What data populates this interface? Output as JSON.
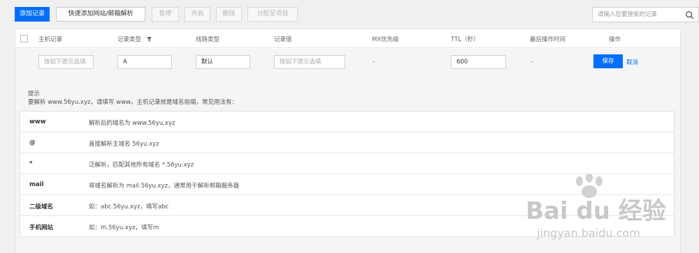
{
  "toolbar": {
    "add_record": "添加记录",
    "quick_add": "快速添加网站/邮箱解析",
    "pause": "暂停",
    "enable": "开启",
    "delete": "删除",
    "assign_project": "分配至项目"
  },
  "search": {
    "placeholder": "请输入您要搜索的记录"
  },
  "table": {
    "headers": {
      "host": "主机记录",
      "type": "记录类型",
      "line": "线路类型",
      "value": "记录值",
      "mx": "MX优先级",
      "ttl": "TTL（秒）",
      "last_op": "最后操作时间",
      "action": "操作"
    }
  },
  "edit_row": {
    "host_placeholder": "按如下提示选填",
    "type_value": "A",
    "line_value": "默认",
    "value_placeholder": "按如下提示选填",
    "mx_value": "-",
    "ttl_value": "600",
    "last_op_value": "-",
    "save": "保存",
    "cancel": "取消"
  },
  "tips": {
    "title": "提示",
    "description": "要解析 www.56yu.xyz，请填写 www。主机记录就是域名前缀，常见用法有：",
    "rows": [
      {
        "key": "www",
        "desc": "解析后的域名为 www.56yu.xyz"
      },
      {
        "key": "@",
        "desc": "直接解析主域名 56yu.xyz"
      },
      {
        "key": "*",
        "desc": "泛解析，匹配其他所有域名 *.56yu.xyz"
      },
      {
        "key": "mail",
        "desc": "将域名解析为 mail.56yu.xyz，通常用于解析邮箱服务器"
      },
      {
        "key": "二级域名",
        "desc": "如：abc.56yu.xyz，填写abc"
      },
      {
        "key": "手机网站",
        "desc": "如：m.56yu.xyz，填写m"
      }
    ]
  },
  "watermark": {
    "brand": "Bai du 经验",
    "url": "jingyan.baidu.com"
  },
  "colors": {
    "primary": "#006eff",
    "page_bg": "#f0f0f0"
  }
}
